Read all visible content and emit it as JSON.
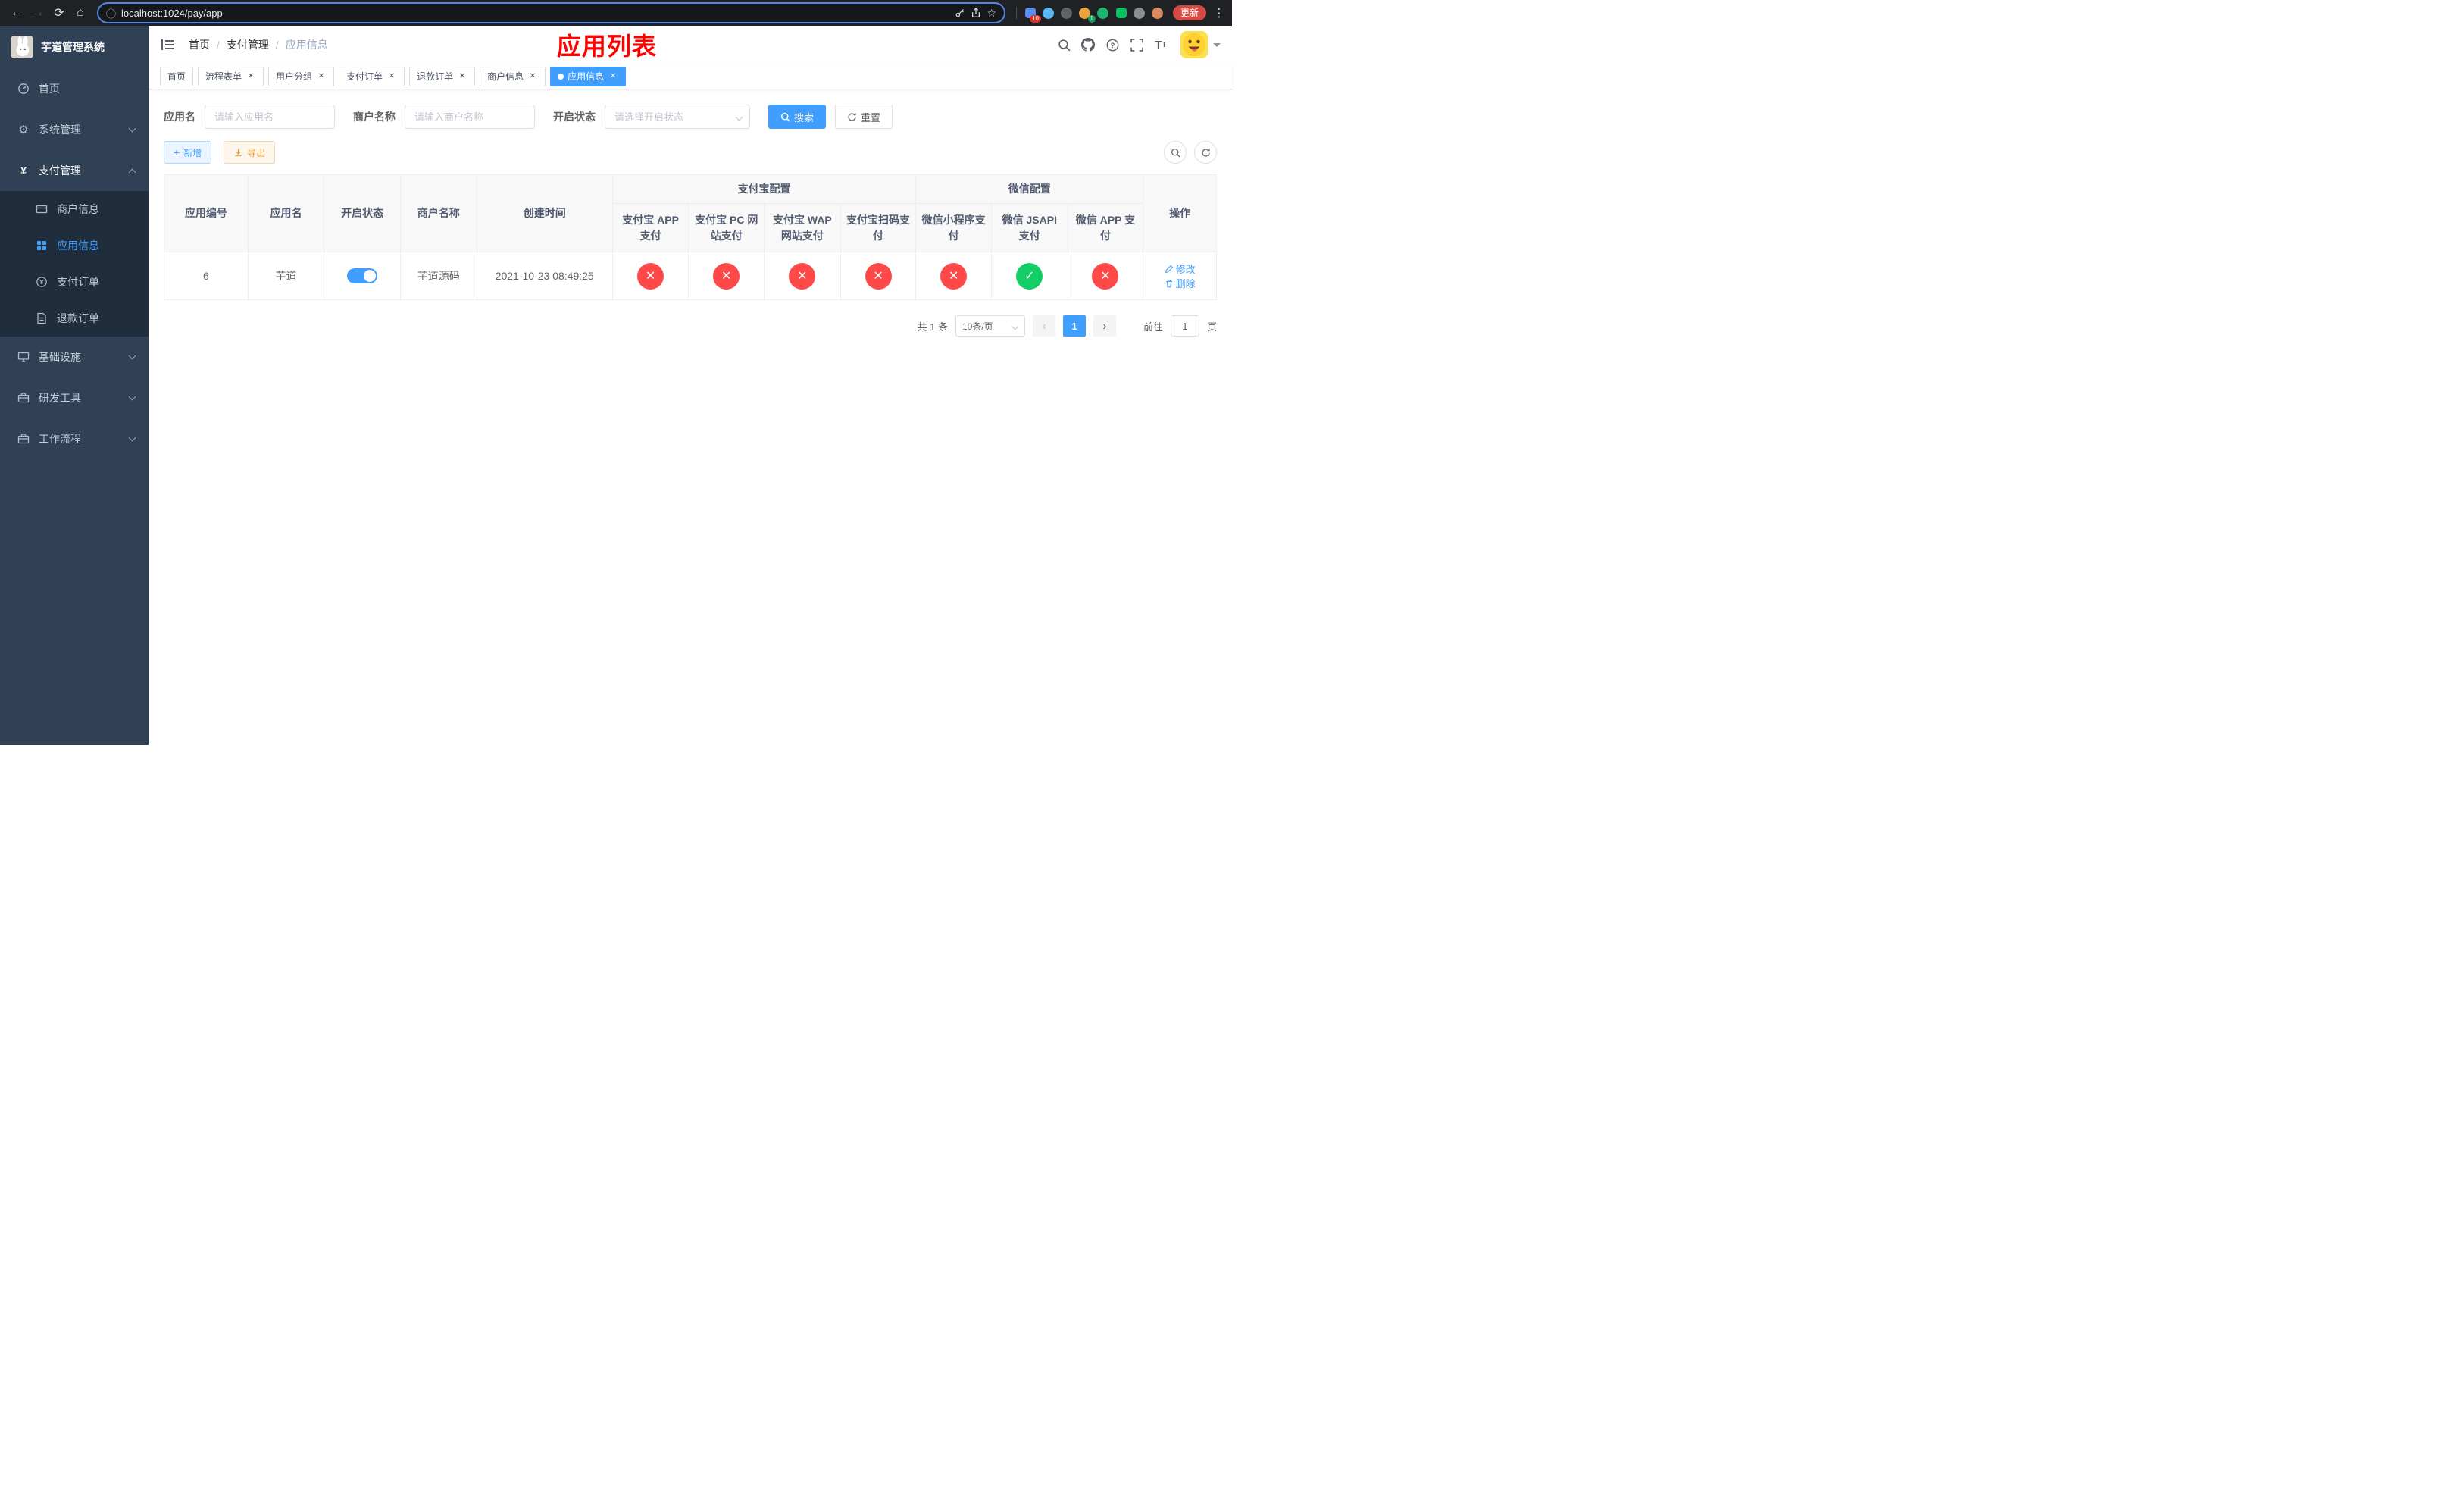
{
  "colors": {
    "primary": "#409EFF",
    "success": "#13ce66",
    "danger": "#ff4949",
    "warning": "#e6a23c",
    "annotation": "#ff0000",
    "sidebar_bg": "#304156",
    "submenu_bg": "#1f2d3d"
  },
  "browser": {
    "url": "localhost:1024/pay/app",
    "update_label": "更新",
    "extensions_badge": "10",
    "avatar_badge": "1"
  },
  "sidebar": {
    "title": "芋道管理系统",
    "items": [
      {
        "label": "首页"
      },
      {
        "label": "系统管理"
      },
      {
        "label": "支付管理"
      },
      {
        "label": "基础设施"
      },
      {
        "label": "研发工具"
      },
      {
        "label": "工作流程"
      }
    ],
    "payment_children": [
      {
        "label": "商户信息"
      },
      {
        "label": "应用信息"
      },
      {
        "label": "支付订单"
      },
      {
        "label": "退款订单"
      }
    ]
  },
  "navbar": {
    "breadcrumb": [
      "首页",
      "支付管理",
      "应用信息"
    ],
    "annotation": "应用列表"
  },
  "tabs": [
    {
      "label": "首页"
    },
    {
      "label": "流程表单"
    },
    {
      "label": "用户分组"
    },
    {
      "label": "支付订单"
    },
    {
      "label": "退款订单"
    },
    {
      "label": "商户信息"
    },
    {
      "label": "应用信息"
    }
  ],
  "filters": {
    "app_name_label": "应用名",
    "app_name_placeholder": "请输入应用名",
    "merchant_label": "商户名称",
    "merchant_placeholder": "请输入商户名称",
    "status_label": "开启状态",
    "status_placeholder": "请选择开启状态",
    "search_label": "搜索",
    "reset_label": "重置"
  },
  "toolbar": {
    "add_label": "新增",
    "export_label": "导出"
  },
  "table": {
    "headers": {
      "id": "应用编号",
      "name": "应用名",
      "status": "开启状态",
      "merchant": "商户名称",
      "created": "创建时间",
      "alipay_group": "支付宝配置",
      "wechat_group": "微信配置",
      "alipay_app": "支付宝 APP 支付",
      "alipay_pc": "支付宝 PC 网站支付",
      "alipay_wap": "支付宝 WAP 网站支付",
      "alipay_qr": "支付宝扫码支付",
      "wx_mini": "微信小程序支付",
      "wx_jsapi": "微信 JSAPI 支付",
      "wx_app": "微信 APP 支付",
      "actions": "操作"
    },
    "rows": [
      {
        "id": "6",
        "name": "芋道",
        "enabled": true,
        "merchant": "芋道源码",
        "created": "2021-10-23 08:49:25",
        "alipay_app": false,
        "alipay_pc": false,
        "alipay_wap": false,
        "alipay_qr": false,
        "wx_mini": false,
        "wx_jsapi": true,
        "wx_app": false,
        "edit_label": "修改",
        "delete_label": "删除"
      }
    ]
  },
  "pagination": {
    "total_text": "共 1 条",
    "page_size_text": "10条/页",
    "current_page": "1",
    "goto_label": "前往",
    "goto_value": "1",
    "page_unit": "页"
  }
}
